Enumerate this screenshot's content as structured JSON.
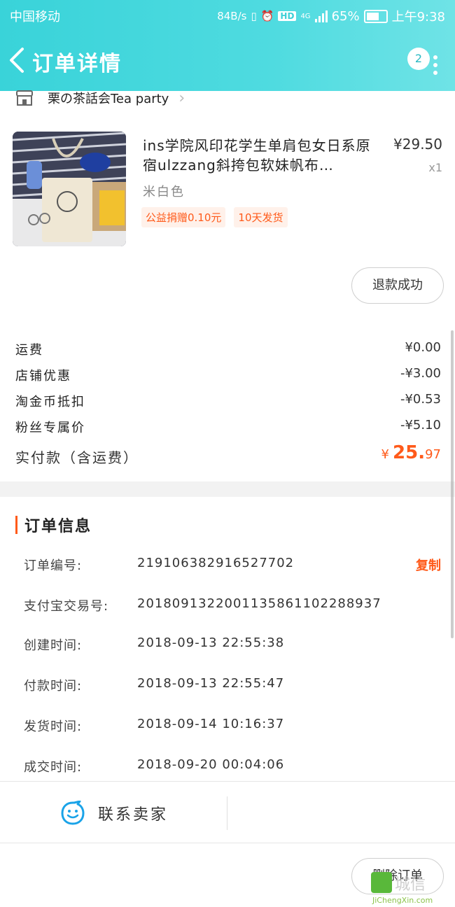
{
  "status_bar": {
    "carrier": "中国移动",
    "net_speed": "84B/s",
    "hd": "HD",
    "network": "4G",
    "battery": "65%",
    "battery_level": 0.65,
    "time": "上午9:38"
  },
  "nav": {
    "title": "订单详情",
    "message_count": "2"
  },
  "shop": {
    "name": "栗の茶話会Tea party"
  },
  "product": {
    "title": "ins学院风印花学生单肩包女日系原宿ulzzang斜挎包软妹帆布…",
    "price": "¥29.50",
    "quantity": "x1",
    "sku": "米白色",
    "tags": [
      "公益捐赠0.10元",
      "10天发货"
    ]
  },
  "buttons": {
    "refund_status": "退款成功",
    "delete_order": "删除订单",
    "copy": "复制",
    "contact_seller": "联系卖家"
  },
  "fees": [
    {
      "label": "运费",
      "value": "¥0.00"
    },
    {
      "label": "店铺优惠",
      "value": "-¥3.00"
    },
    {
      "label": "淘金币抵扣",
      "value": "-¥0.53"
    },
    {
      "label": "粉丝专属价",
      "value": "-¥5.10"
    }
  ],
  "total": {
    "label": "实付款（含运费）",
    "currency": "¥",
    "integer": "25.",
    "decimal": "97"
  },
  "order_info": {
    "title": "订单信息",
    "rows": [
      {
        "label": "订单编号:",
        "value": "219106382916527702"
      },
      {
        "label": "支付宝交易号:",
        "value": "2018091322001135861102288937"
      },
      {
        "label": "创建时间:",
        "value": "2018-09-13 22:55:38"
      },
      {
        "label": "付款时间:",
        "value": "2018-09-13 22:55:47"
      },
      {
        "label": "发货时间:",
        "value": "2018-09-14 10:16:37"
      },
      {
        "label": "成交时间:",
        "value": "2018-09-20 00:04:06"
      }
    ]
  },
  "watermark": {
    "text": "城信",
    "url": "JiChengXin.com"
  },
  "colors": {
    "header_start": "#39d3d9",
    "accent_orange": "#ff5a1a",
    "tag_bg": "#fff1ea"
  }
}
